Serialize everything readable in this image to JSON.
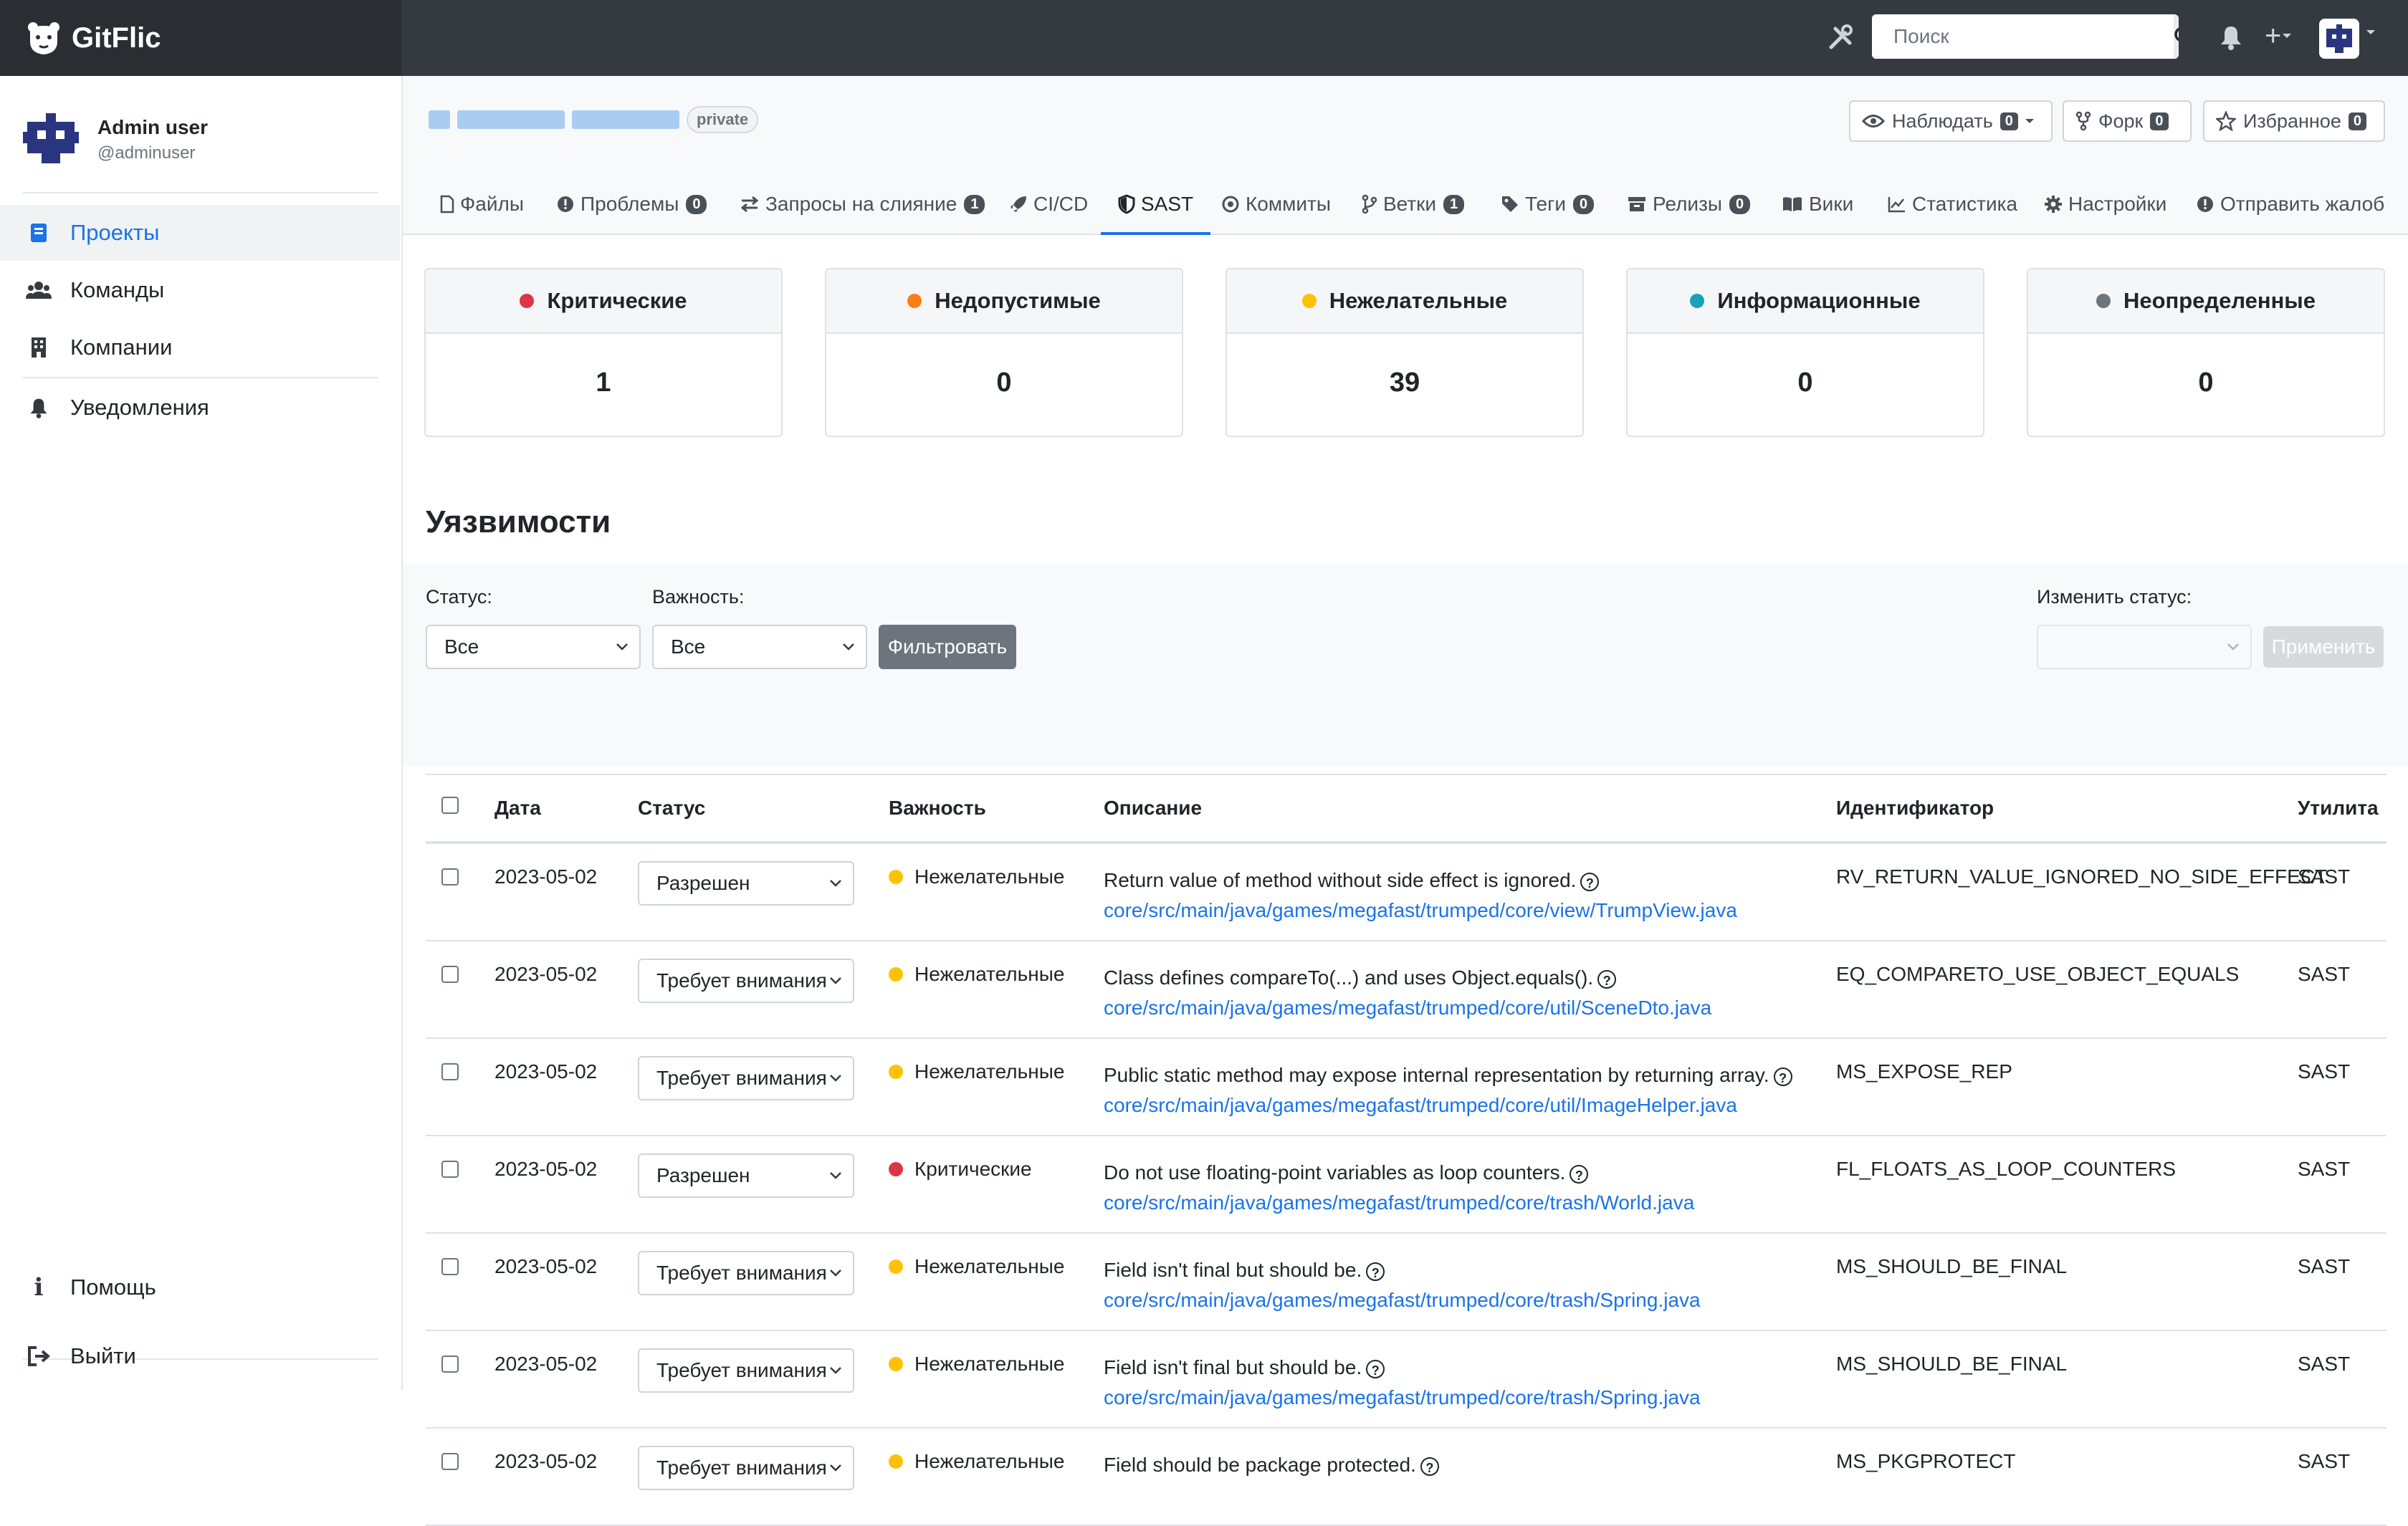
{
  "topbar": {
    "brand": "GitFlic",
    "search_placeholder": "Поиск"
  },
  "sidebar": {
    "user_name": "Admin user",
    "user_login": "@adminuser",
    "items": [
      {
        "label": "Проекты",
        "icon": "book-icon",
        "active": true
      },
      {
        "label": "Команды",
        "icon": "users-icon"
      },
      {
        "label": "Компании",
        "icon": "building-icon"
      },
      {
        "label": "Уведомления",
        "icon": "bell-icon"
      }
    ],
    "help": "Помощь",
    "logout": "Выйти"
  },
  "repo": {
    "visibility": "private",
    "watch": {
      "label": "Наблюдать",
      "count": "0"
    },
    "fork": {
      "label": "Форк",
      "count": "0"
    },
    "star": {
      "label": "Избранное",
      "count": "0"
    }
  },
  "tabs": [
    {
      "label": "Файлы",
      "icon": "file-icon"
    },
    {
      "label": "Проблемы",
      "icon": "issue-icon",
      "count": "0"
    },
    {
      "label": "Запросы на слияние",
      "icon": "merge-icon",
      "count": "1"
    },
    {
      "label": "CI/CD",
      "icon": "rocket-icon"
    },
    {
      "label": "SAST",
      "icon": "shield-icon",
      "active": true
    },
    {
      "label": "Коммиты",
      "icon": "commit-icon"
    },
    {
      "label": "Ветки",
      "icon": "branch-icon",
      "count": "1"
    },
    {
      "label": "Теги",
      "icon": "tag-icon",
      "count": "0"
    },
    {
      "label": "Релизы",
      "icon": "release-icon",
      "count": "0"
    },
    {
      "label": "Вики",
      "icon": "wiki-icon"
    },
    {
      "label": "Статистика",
      "icon": "chart-icon"
    },
    {
      "label": "Настройки",
      "icon": "gear-icon"
    },
    {
      "label": "Отправить жалоб",
      "icon": "alert-icon"
    }
  ],
  "severity_cards": [
    {
      "label": "Критические",
      "value": "1",
      "color": "#dc3545"
    },
    {
      "label": "Недопустимые",
      "value": "0",
      "color": "#fd7e14"
    },
    {
      "label": "Нежелательные",
      "value": "39",
      "color": "#ffc107"
    },
    {
      "label": "Информационные",
      "value": "0",
      "color": "#17a2b8"
    },
    {
      "label": "Неопределенные",
      "value": "0",
      "color": "#6c757d"
    }
  ],
  "vuln": {
    "title": "Уязвимости",
    "status_label": "Статус:",
    "status_value": "Все",
    "severity_label": "Важность:",
    "severity_value": "Все",
    "filter_button": "Фильтровать",
    "change_status_label": "Изменить статус:",
    "apply_button": "Применить"
  },
  "table": {
    "headers": [
      "Дата",
      "Статус",
      "Важность",
      "Описание",
      "Идентификатор",
      "Утилита"
    ],
    "rows": [
      {
        "date": "2023-05-02",
        "status": "Разрешен",
        "severity": "Нежелательные",
        "sev_color": "#ffc107",
        "desc": "Return value of method without side effect is ignored.",
        "path": "core/src/main/java/games/megafast/trumped/core/view/TrumpView.java",
        "id": "RV_RETURN_VALUE_IGNORED_NO_SIDE_EFFECT",
        "tool": "SAST"
      },
      {
        "date": "2023-05-02",
        "status": "Требует внимания",
        "severity": "Нежелательные",
        "sev_color": "#ffc107",
        "desc": "Class defines compareTo(...) and uses Object.equals().",
        "path": "core/src/main/java/games/megafast/trumped/core/util/SceneDto.java",
        "id": "EQ_COMPARETO_USE_OBJECT_EQUALS",
        "tool": "SAST"
      },
      {
        "date": "2023-05-02",
        "status": "Требует внимания",
        "severity": "Нежелательные",
        "sev_color": "#ffc107",
        "desc": "Public static method may expose internal representation by returning array.",
        "path": "core/src/main/java/games/megafast/trumped/core/util/ImageHelper.java",
        "id": "MS_EXPOSE_REP",
        "tool": "SAST"
      },
      {
        "date": "2023-05-02",
        "status": "Разрешен",
        "severity": "Критические",
        "sev_color": "#dc3545",
        "desc": "Do not use floating-point variables as loop counters.",
        "path": "core/src/main/java/games/megafast/trumped/core/trash/World.java",
        "id": "FL_FLOATS_AS_LOOP_COUNTERS",
        "tool": "SAST"
      },
      {
        "date": "2023-05-02",
        "status": "Требует внимания",
        "severity": "Нежелательные",
        "sev_color": "#ffc107",
        "desc": "Field isn't final but should be.",
        "path": "core/src/main/java/games/megafast/trumped/core/trash/Spring.java",
        "id": "MS_SHOULD_BE_FINAL",
        "tool": "SAST"
      },
      {
        "date": "2023-05-02",
        "status": "Требует внимания",
        "severity": "Нежелательные",
        "sev_color": "#ffc107",
        "desc": "Field isn't final but should be.",
        "path": "core/src/main/java/games/megafast/trumped/core/trash/Spring.java",
        "id": "MS_SHOULD_BE_FINAL",
        "tool": "SAST"
      },
      {
        "date": "2023-05-02",
        "status": "Требует внимания",
        "severity": "Нежелательные",
        "sev_color": "#ffc107",
        "desc": "Field should be package protected.",
        "path": "",
        "id": "MS_PKGPROTECT",
        "tool": "SAST"
      }
    ]
  }
}
